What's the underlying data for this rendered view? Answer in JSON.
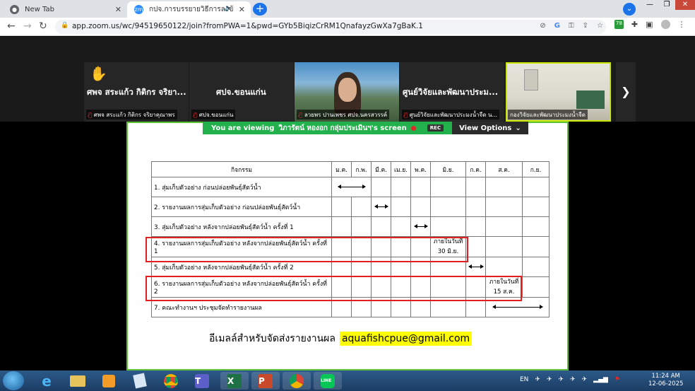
{
  "browser": {
    "tabs": [
      {
        "title": "New Tab",
        "icon": "chrome-icon"
      },
      {
        "title": "กปจ.การบรรยายวิธีการลงข้อมูลส",
        "icon": "zoom-icon",
        "favicon_text": "zm"
      }
    ],
    "profile_initial": "v",
    "url": "app.zoom.us/wc/94519650122/join?fromPWA=1&pwd=GYb5BiqizCrRM1QnafayzGwXa7gBaK.1",
    "badge": "78"
  },
  "gallery": {
    "tiles": [
      {
        "big_name": "ศพจ สระแก้ว กิติกร จริยา...",
        "label": "ศพจ สระแก้ว กิติกร จริยาคุณาพร",
        "raised_hand": true,
        "video": false
      },
      {
        "big_name": "ศปจ.ขอนแก่น",
        "label": "ศปจ.ขอนแก่น",
        "video": false
      },
      {
        "big_name": "",
        "label": "ลวยพร ปานเพชร ศปจ.นครสวรรค์",
        "video": true
      },
      {
        "big_name": "ศูนย์วิจัยและพัฒนาประม...",
        "label": "ศูนย์วิจัยและพัฒนาประมงน้ำจืด น...",
        "video": false
      },
      {
        "big_name": "",
        "label": "กองวิจัยและพัฒนาประมงน้ำจืด",
        "video": true,
        "active_speaker": true
      }
    ]
  },
  "share": {
    "viewing_prefix": "You are viewing",
    "viewing_name": "วิภารัตน์ หองอก กลุ่มประเมินฯ's screen",
    "rec": "REC",
    "view_options": "View Options"
  },
  "slide": {
    "header_activity": "กิจกรรม",
    "months": [
      "ม.ค.",
      "ก.พ.",
      "มี.ค.",
      "เม.ย.",
      "พ.ค.",
      "มิ.ย.",
      "ก.ค.",
      "ส.ค.",
      "ก.ย."
    ],
    "rows": [
      {
        "activity": "1. สุ่มเก็บตัวอย่าง ก่อนปล่อยพันธุ์สัตว์น้ำ"
      },
      {
        "activity": "2. รายงานผลการสุ่มเก็บตัวอย่าง ก่อนปล่อยพันธุ์สัตว์น้ำ"
      },
      {
        "activity": "3. สุ่มเก็บตัวอย่าง หลังจากปล่อยพันธุ์สัตว์น้ำ ครั้งที่ 1"
      },
      {
        "activity": "4. รายงานผลการสุ่มเก็บตัวอย่าง หลังจากปล่อยพันธุ์สัตว์น้ำ ครั้งที่ 1",
        "note": [
          "ภายในวันที่",
          "30 มิ.ย."
        ]
      },
      {
        "activity": "5. สุ่มเก็บตัวอย่าง หลังจากปล่อยพันธุ์สัตว์น้ำ ครั้งที่ 2"
      },
      {
        "activity": "6. รายงานผลการสุ่มเก็บตัวอย่าง หลังจากปล่อยพันธุ์สัตว์น้ำ ครั้งที่ 2",
        "note": [
          "ภายในวันที่",
          "15 ส.ค."
        ]
      },
      {
        "activity": "7. คณะทำงานฯ ประชุมจัดทำรายงานผล"
      }
    ],
    "email_label": "อีเมลล์สำหรับจัดส่งรายงานผล",
    "email": "aquafishcpue@gmail.com",
    "highlight_color": "#ffff00",
    "box_color": "#e02020"
  },
  "taskbar": {
    "apps": [
      "ie-icon",
      "explorer-icon",
      "media-icon",
      "notepad-icon",
      "chrome-icon",
      "teams-icon",
      "excel-icon",
      "powerpoint-icon",
      "chrome-icon",
      "line-icon"
    ],
    "lang": "EN",
    "time": "11:24 AM",
    "date": "12-06-2025"
  }
}
